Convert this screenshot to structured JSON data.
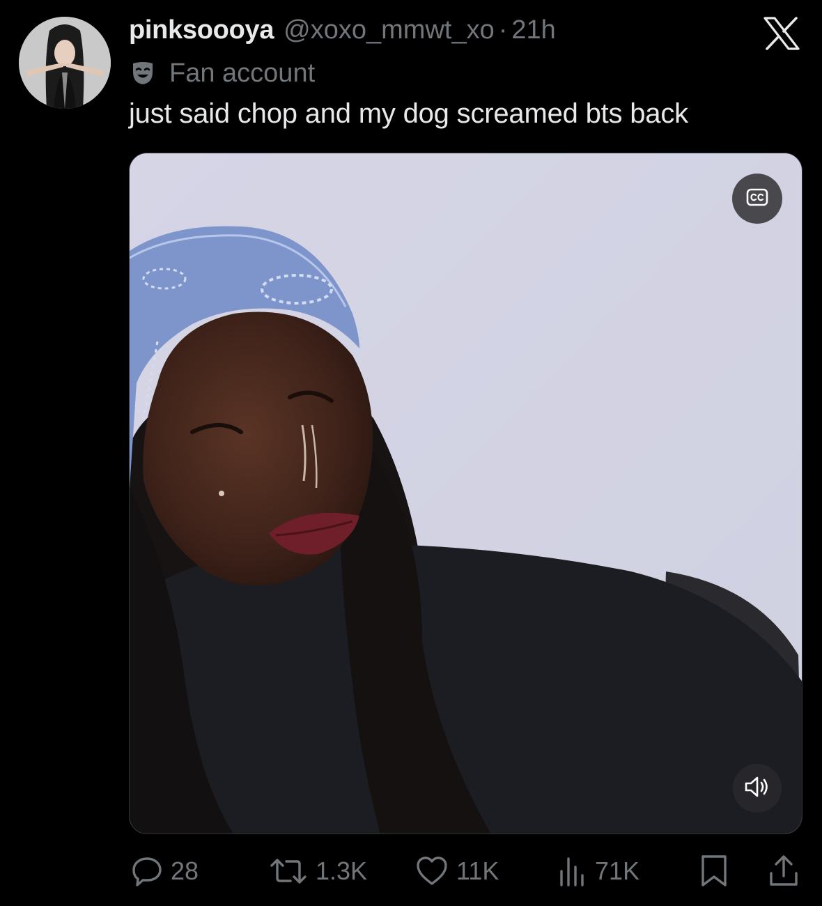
{
  "tweet": {
    "display_name": "pinksoooya",
    "handle": "@xoxo_mmwt_xo",
    "separator": "·",
    "time": "21h",
    "badge_label": "Fan account",
    "text": "just said chop and my dog screamed bts back"
  },
  "media": {
    "type": "video",
    "cc_icon": "closed-captions-icon",
    "volume_icon": "speaker-icon"
  },
  "actions": {
    "replies": "28",
    "reposts": "1.3K",
    "likes": "11K",
    "views": "71K"
  },
  "icons": {
    "platform": "x-logo-icon",
    "badge": "theater-mask-icon",
    "reply": "reply-bubble-icon",
    "repost": "repost-arrows-icon",
    "like": "heart-icon",
    "views": "bar-chart-icon",
    "bookmark": "bookmark-icon",
    "share": "share-icon"
  },
  "colors": {
    "background": "#000000",
    "primary_text": "#e7e9ea",
    "secondary_text": "#71767b",
    "video_backdrop": "#d6d6e6",
    "bandana": "#7e95cc"
  }
}
